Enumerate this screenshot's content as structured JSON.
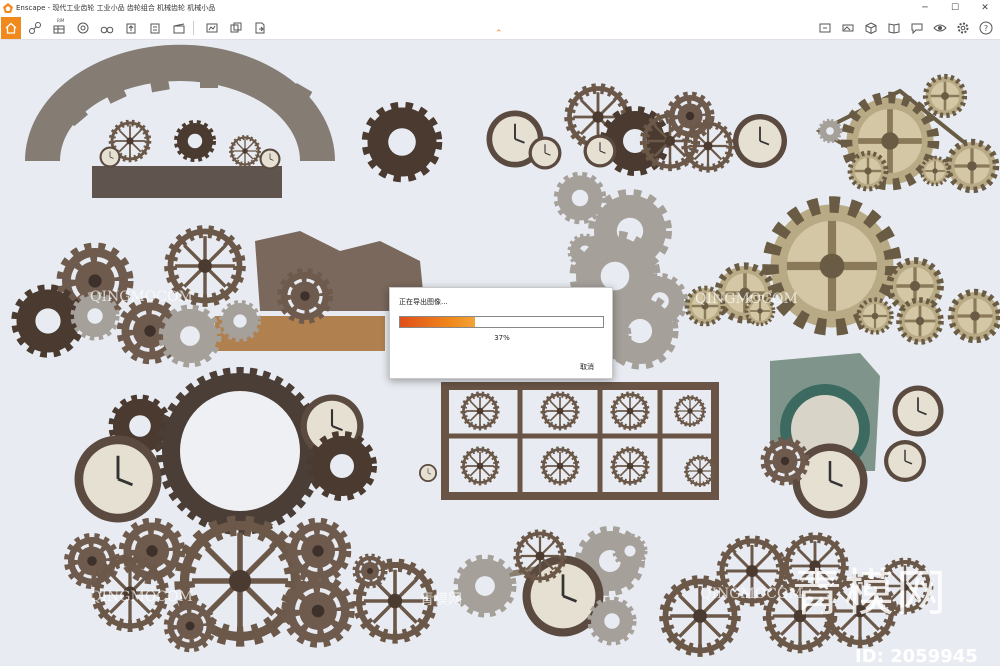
{
  "window": {
    "title": "Enscape - 现代工业齿轮 工业小品 齿轮组合 机械齿轮 机械小品",
    "minimize": "─",
    "maximize": "☐",
    "close": "✕"
  },
  "toolbar": {
    "bim_label": "BIM",
    "help_label": "?",
    "accent_color": "#f08a1c"
  },
  "dialog": {
    "title": "正在导出图像...",
    "progress_text": "37%",
    "progress_value": 0.37,
    "cancel_label": "取消"
  },
  "watermark": {
    "brand": "青模网",
    "id": "ID: 2059945",
    "faint": "青模网",
    "faint_latin": "QINGMOCOM"
  }
}
